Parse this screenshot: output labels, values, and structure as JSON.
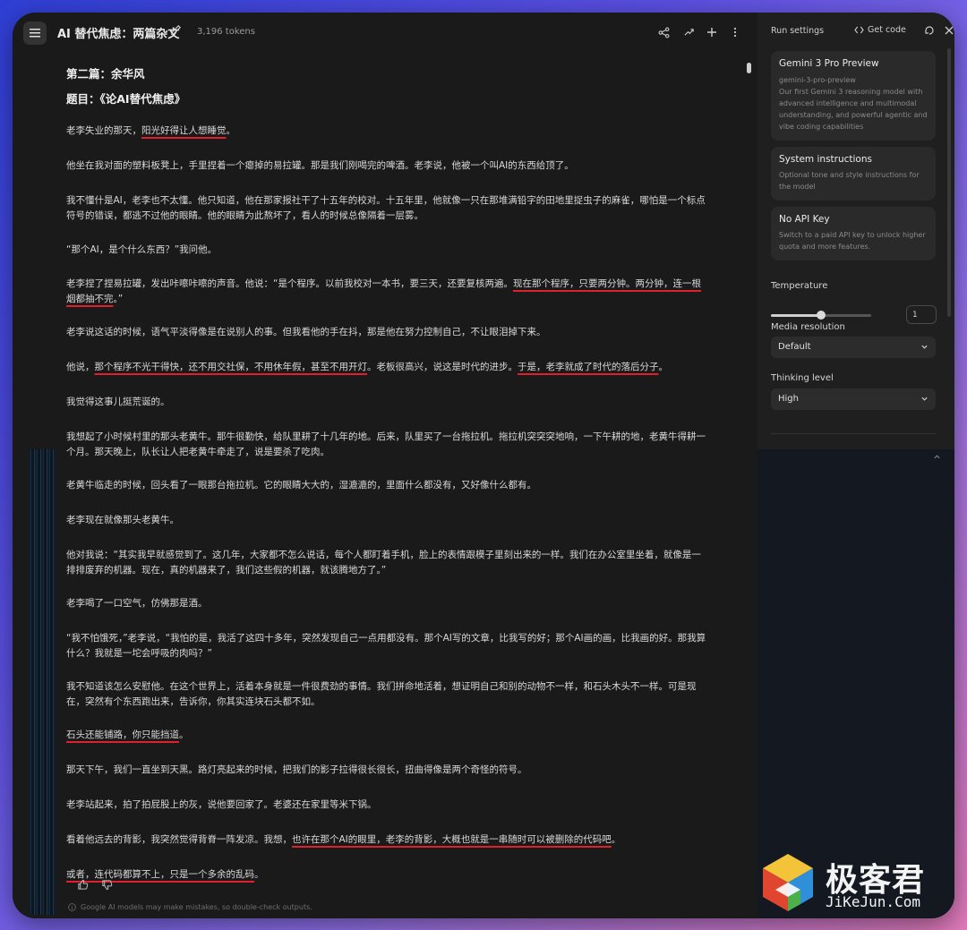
{
  "header": {
    "title": "AI 替代焦虑：两篇杂文",
    "tokens": "3,196 tokens"
  },
  "article": {
    "part_title": "第二篇：余华风",
    "essay_title": "题目：《论AI替代焦虑》",
    "p1_a": "老李失业的那天，",
    "p1_u": "阳光好得让人想睡觉",
    "p1_b": "。",
    "p2": "他坐在我对面的塑料板凳上，手里捏着一个瘪掉的易拉罐。那是我们刚喝完的啤酒。老李说，他被一个叫AI的东西给顶了。",
    "p3": "我不懂什是AI，老李也不太懂。他只知道，他在那家报社干了十五年的校对。十五年里，他就像一只在那堆满铅字的田地里捉虫子的麻雀，哪怕是一个标点符号的错误，都逃不过他的眼睛。他的眼睛为此熬坏了，看人的时候总像隔着一层雾。",
    "p4": "“那个AI，是个什么东西？”我问他。",
    "p5_a": "老李捏了捏易拉罐，发出咔嚓咔嚓的声音。他说：“是个程序。以前我校对一本书，要三天，还要复核两遍。",
    "p5_u1": "现在那个程序，只要两分钟。两分钟，连一根烟都",
    "p5_u2": "抽不完",
    "p5_b": "。”",
    "p6": "老李说这话的时候，语气平淡得像是在说别人的事。但我看他的手在抖，那是他在努力控制自己，不让眼泪掉下来。",
    "p7_a": "他说，",
    "p7_u1": "那个程序不光干得快，还不用交社保，不用休年假，甚至不用开灯",
    "p7_b": "。老板很高兴，说这是时代的进步。",
    "p7_u2": "于是，老李就成了时代的落后分子",
    "p7_c": "。",
    "p8": "我觉得这事儿挺荒诞的。",
    "p9": "我想起了小时候村里的那头老黄牛。那牛很勤快，给队里耕了十几年的地。后来，队里买了一台拖拉机。拖拉机突突突地响，一下午耕的地，老黄牛得耕一个月。那天晚上，队长让人把老黄牛牵走了，说是要杀了吃肉。",
    "p10": "老黄牛临走的时候，回头看了一眼那台拖拉机。它的眼睛大大的，湿漉漉的，里面什么都没有，又好像什么都有。",
    "p11": "老李现在就像那头老黄牛。",
    "p12": "他对我说：“其实我早就感觉到了。这几年，大家都不怎么说话，每个人都盯着手机，脸上的表情跟模子里刻出来的一样。我们在办公室里坐着，就像是一排排废弃的机器。现在，真的机器来了，我们这些假的机器，就该腾地方了。”",
    "p13": "老李喝了一口空气，仿佛那是酒。",
    "p14": "“我不怕饿死，”老李说，“我怕的是，我活了这四十多年，突然发现自己一点用都没有。那个AI写的文章，比我写的好；那个AI画的画，比我画的好。那我算什么？我就是一坨会呼吸的肉吗？”",
    "p15": "我不知道该怎么安慰他。在这个世界上，活着本身就是一件很费劲的事情。我们拼命地活着，想证明自己和别的动物不一样，和石头木头不一样。可是现在，突然有个东西跑出来，告诉你，你其实连块石头都不如。",
    "p16_u": "石头还能铺路，你只能挡道",
    "p16_b": "。",
    "p17": "那天下午，我们一直坐到天黑。路灯亮起来的时候，把我们的影子拉得很长很长，扭曲得像是两个奇怪的符号。",
    "p18": "老李站起来，拍了拍屁股上的灰，说他要回家了。老婆还在家里等米下锅。",
    "p19_a": "看着他远去的背影，我突然觉得背脊一阵发凉。我想，",
    "p19_u": "也许在那个AI的眼里，老李的背影，大概也就是一串随时可以被删除的代码吧",
    "p19_b": "。",
    "p20_u": "或者，连代码都算不上，只是一个多余的乱码",
    "p20_b": "。"
  },
  "footer": {
    "disclaimer": "Google AI models may make mistakes, so double-check outputs."
  },
  "panel": {
    "heading": "Run settings",
    "get_code": "Get code",
    "model": {
      "name": "Gemini 3 Pro Preview",
      "id": "gemini-3-pro-preview",
      "desc": "Our first Gemini 3 reasoning model with advanced intelligence and multimodal understanding, and powerful agentic and vibe coding capabilities"
    },
    "system": {
      "title": "System instructions",
      "desc": "Optional tone and style instructions for the model"
    },
    "api": {
      "title": "No API Key",
      "desc": "Switch to a paid API key to unlock higher quota and more features."
    },
    "temperature_label": "Temperature",
    "temperature_value": "1",
    "temperature_fraction": 0.5,
    "media_label": "Media resolution",
    "media_value": "Default",
    "thinking_label": "Thinking level",
    "thinking_value": "High"
  },
  "watermark": {
    "cn": "极客君",
    "en": "JiKeJun.Com"
  },
  "colors": {
    "underline": "#e0202a",
    "background": "#1a1a1a"
  }
}
